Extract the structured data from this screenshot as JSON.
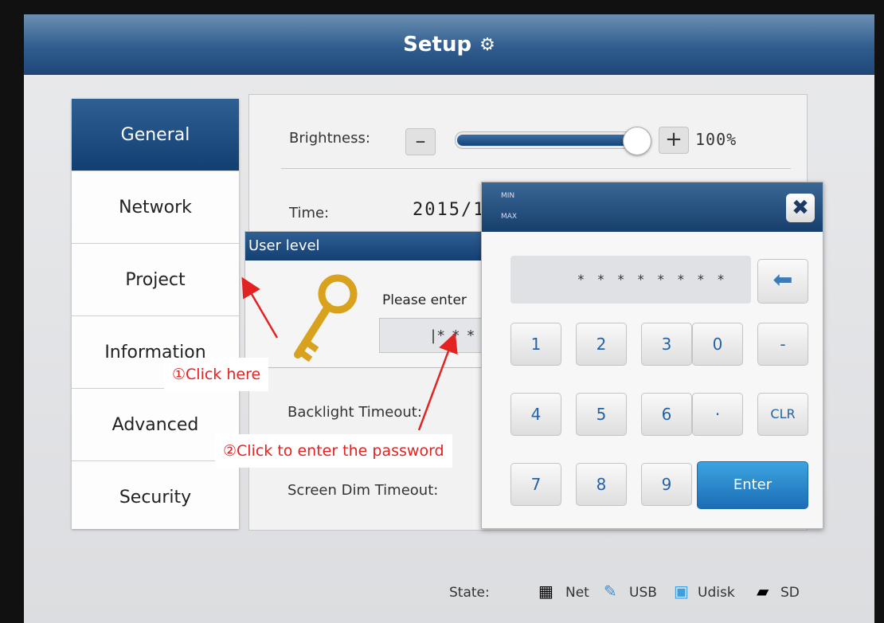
{
  "title": "Setup",
  "title_icon": "gear-icon",
  "sidebar": {
    "items": [
      {
        "label": "General"
      },
      {
        "label": "Network"
      },
      {
        "label": "Project"
      },
      {
        "label": "Information"
      },
      {
        "label": "Advanced"
      },
      {
        "label": "Security"
      }
    ],
    "active": "General"
  },
  "general": {
    "brightness_label": "Brightness:",
    "brightness_minus": "–",
    "brightness_plus": "+",
    "brightness_value": "100%",
    "brightness_level": 1.0,
    "time_label": "Time:",
    "time_value": "2015/1",
    "backlight_label": "Backlight Timeout:",
    "screendim_label": "Screen Dim Timeout:"
  },
  "user_level_dialog": {
    "title": "User level",
    "prompt": "Please enter",
    "password_mask": "|* * *"
  },
  "keypad": {
    "min_label": "MIN",
    "max_label": "MAX",
    "close_label": "✖",
    "display_mask": "* * * * * * * *",
    "back_label": "⬅",
    "keys": [
      "1",
      "2",
      "3",
      "0",
      "-",
      "4",
      "5",
      "6",
      "·",
      "CLR",
      "7",
      "8",
      "9",
      "Enter"
    ]
  },
  "status": {
    "label": "State:",
    "items": [
      {
        "label": "Net",
        "icon": "network-icon"
      },
      {
        "label": "USB",
        "icon": "usb-icon"
      },
      {
        "label": "Udisk",
        "icon": "udisk-icon"
      },
      {
        "label": "SD",
        "icon": "sd-card-icon"
      }
    ]
  },
  "annotations": {
    "callout_1": "①Click here",
    "callout_2": "②Click to enter the password",
    "color": "#e32222"
  },
  "colors": {
    "title_bar": "#2f5d8e",
    "accent_blue": "#2563a5",
    "enter_button": "#1c6db5"
  }
}
